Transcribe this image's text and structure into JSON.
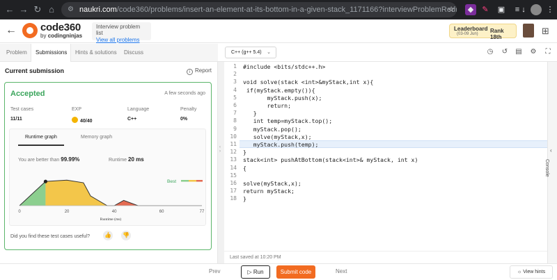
{
  "browser": {
    "url_host": "naukri.com",
    "url_path": "/code360/problems/insert-an-element-at-its-bottom-in-a-given-stack_1171166?interviewProblemRedirection=true&search=stack..."
  },
  "header": {
    "logo_top": "code360",
    "logo_by": "by",
    "logo_brand": "codingninjas",
    "problem_list_label": "Interview problem list",
    "view_all": "View all problems",
    "leaderboard_title": "Leaderboard",
    "leaderboard_dates": "(03-09 Jun)",
    "rank": "Rank 18th"
  },
  "left_tabs": [
    "Problem",
    "Submissions",
    "Hints & solutions",
    "Discuss"
  ],
  "editor_toolbar": {
    "language": "C++ (g++ 5.4)"
  },
  "submission": {
    "title": "Current submission",
    "report": "Report",
    "status": "Accepted",
    "time_ago": "A few seconds ago",
    "stats": [
      {
        "label": "Test cases",
        "value": "11/11"
      },
      {
        "label": "EXP",
        "value": "40/40"
      },
      {
        "label": "Language",
        "value": "C++"
      },
      {
        "label": "Penalty",
        "value": "0%"
      }
    ],
    "graph_tabs": [
      "Runtime graph",
      "Memory graph"
    ],
    "better_label": "You are better than",
    "better_value": "99.99%",
    "runtime_label": "Runtime",
    "runtime_value": "20 ms",
    "useful_question": "Did you find these test cases useful?"
  },
  "chart_data": {
    "type": "area",
    "title": "",
    "xlabel": "Runtime (ms)",
    "ylabel": "",
    "x_ticks": [
      0,
      20,
      40,
      60,
      77
    ],
    "xlim": [
      0,
      77
    ],
    "legend": "Best",
    "your_runtime": 11,
    "series": [
      {
        "x": [
          0,
          11,
          20,
          27,
          30,
          37,
          40,
          44,
          50,
          77
        ],
        "y": [
          0,
          0.55,
          0.58,
          0.52,
          0.22,
          0.0,
          0.0,
          0.12,
          0.0,
          0.0
        ]
      }
    ],
    "colors": {
      "green": "#8ccf8f",
      "yellow": "#f3c64a",
      "red": "#e46b52"
    }
  },
  "code": {
    "lines": [
      "#include <bits/stdc++.h>",
      "",
      "void solve(stack <int>&myStack,int x){",
      " if(myStack.empty()){",
      "       myStack.push(x);",
      "       return;",
      "   }",
      "   int temp=myStack.top();",
      "   myStack.pop();",
      "   solve(myStack,x);",
      "   myStack.push(temp);",
      "}",
      "stack<int> pushAtBottom(stack<int>& myStack, int x)",
      "{",
      "",
      "solve(myStack,x);",
      "return myStack;",
      "}"
    ],
    "highlighted_line": 11,
    "last_saved": "Last saved at 10:20 PM"
  },
  "console_label": "Console",
  "bottom": {
    "prev": "Prev",
    "run": "Run",
    "submit": "Submit code",
    "next": "Next",
    "hints": "View hints"
  }
}
